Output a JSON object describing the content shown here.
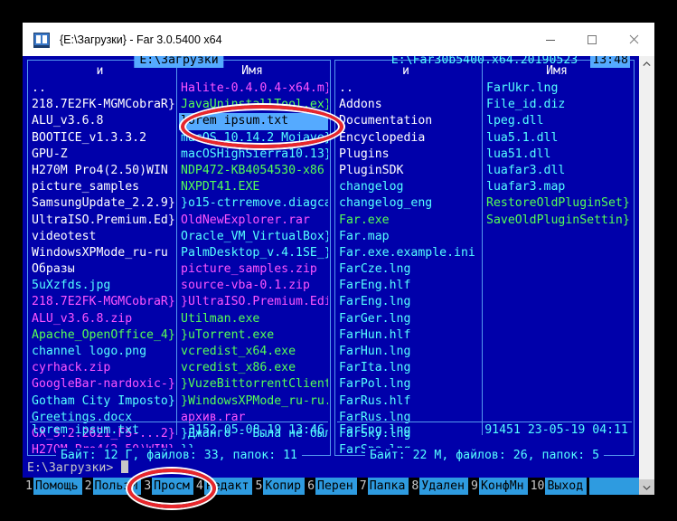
{
  "window": {
    "title": "{E:\\Загрузки} - Far 3.0.5400 x64",
    "icon": "far-manager-icon",
    "minimize_label": "minimize-icon",
    "maximize_label": "maximize-icon",
    "close_label": "close-icon"
  },
  "colors": {
    "panel_bg": "#0000aa",
    "panel_border": "#5599ee",
    "title_highlight": "#55aaff",
    "file_default": "#55ffff",
    "folder": "#ffffff",
    "executable": "#55ff55",
    "archive": "#ff55ff",
    "selection_bg": "#55aaff",
    "keybar_bg": "#2e9be0",
    "annotation": "#e8262b"
  },
  "left_panel": {
    "title": "E:\\Загрузки",
    "col_head_1": "и",
    "col_head_2": "Имя",
    "column_a": [
      {
        "name": "..",
        "type": "dir"
      },
      {
        "name": "218.7E2FK-MGMCobraR",
        "type": "dir",
        "cont": true
      },
      {
        "name": "ALU_v3.6.8",
        "type": "dir"
      },
      {
        "name": "BOOTICE_v1.3.3.2",
        "type": "dir"
      },
      {
        "name": "GPU-Z",
        "type": "dir"
      },
      {
        "name": "H270M Pro4(2.50)WIN",
        "type": "dir"
      },
      {
        "name": "picture_samples",
        "type": "dir"
      },
      {
        "name": "SamsungUpdate_2.2.9",
        "type": "dir",
        "cont": true
      },
      {
        "name": "UltraISO.Premium.Ed",
        "type": "dir",
        "cont": true
      },
      {
        "name": "videotest",
        "type": "dir"
      },
      {
        "name": "WindowsXPMode_ru-ru",
        "type": "dir"
      },
      {
        "name": "Образы",
        "type": "dir"
      },
      {
        "name": "5uXzfds.jpg",
        "type": "file"
      },
      {
        "name": "218.7E2FK-MGMCobraR",
        "type": "arc",
        "cont": true
      },
      {
        "name": "ALU_v3.6.8.zip",
        "type": "arc"
      },
      {
        "name": "Apache_OpenOffice_4",
        "type": "exe",
        "cont": true
      },
      {
        "name": "channel logo.png",
        "type": "file"
      },
      {
        "name": "cyrhack.zip",
        "type": "arc"
      },
      {
        "name": "GoogleBar-nardoxic-",
        "type": "arc",
        "cont": true
      },
      {
        "name": "Gotham City Imposto",
        "type": "file",
        "cont": true
      },
      {
        "name": "Greetings.docx",
        "type": "file"
      },
      {
        "name": "GX_5.2.2621_FS-...2",
        "type": "arc",
        "cont": true
      },
      {
        "name": "H270M Pro4(2.50)WIN",
        "type": "arc",
        "cont": true
      }
    ],
    "column_b": [
      {
        "name": "Halite-0.4.0.4-x64.m",
        "type": "arc",
        "cont": true
      },
      {
        "name": "JavaUninstallTool.ex",
        "type": "exe",
        "cont": true
      },
      {
        "name": "lorem ipsum.txt",
        "type": "file",
        "selected": true
      },
      {
        "name": "macOS_10.14.2_Mojave",
        "type": "file",
        "cont": true
      },
      {
        "name": "macOSHighSierra10.13",
        "type": "file",
        "cont": true
      },
      {
        "name": "NDP472-KB4054530-x86",
        "type": "exe"
      },
      {
        "name": "NXPDT41.EXE",
        "type": "exe"
      },
      {
        "name": "o15-ctrremove.diagca",
        "type": "file",
        "cont": true,
        "lead": true
      },
      {
        "name": "OldNewExplorer.rar",
        "type": "arc"
      },
      {
        "name": "Oracle_VM_VirtualBox",
        "type": "file",
        "cont": true
      },
      {
        "name": "PalmDesktop_v.4.1SE_",
        "type": "file",
        "cont": true
      },
      {
        "name": "picture_samples.zip",
        "type": "arc"
      },
      {
        "name": "source-vba-0.1.zip",
        "type": "arc"
      },
      {
        "name": "UltraISO.Premium.Edi",
        "type": "arc",
        "cont": true,
        "lead": true
      },
      {
        "name": "Utilman.exe",
        "type": "exe"
      },
      {
        "name": "uTorrent.exe",
        "type": "exe",
        "lead": true
      },
      {
        "name": "vcredist_x64.exe",
        "type": "exe"
      },
      {
        "name": "vcredist_x86.exe",
        "type": "exe"
      },
      {
        "name": "VuzeBittorrentClient",
        "type": "exe",
        "cont": true,
        "lead": true
      },
      {
        "name": "WindowsXPMode_ru-ru.",
        "type": "exe",
        "cont": true,
        "lead": true
      },
      {
        "name": "архив.rar",
        "type": "arc"
      },
      {
        "name": "Джанго - Была не был",
        "type": "file",
        "cont": true,
        "lead": true
      },
      {
        "name": "",
        "type": "file",
        "cont": true,
        "lead": true
      }
    ],
    "info_name": "lorem ipsum.txt",
    "info_meta": "3152 05-08-19 13:46",
    "total": "Байт: 12 Г, файлов: 33, папок: 11"
  },
  "right_panel": {
    "title": "E:\\Far30b5400.x64.20190523",
    "clock": "13:48",
    "col_head_1": "и",
    "col_head_2": "Имя",
    "column_a": [
      {
        "name": "..",
        "type": "dir"
      },
      {
        "name": "Addons",
        "type": "dir"
      },
      {
        "name": "Documentation",
        "type": "dir"
      },
      {
        "name": "Encyclopedia",
        "type": "dir"
      },
      {
        "name": "Plugins",
        "type": "dir"
      },
      {
        "name": "PluginSDK",
        "type": "dir"
      },
      {
        "name": "changelog",
        "type": "file"
      },
      {
        "name": "changelog_eng",
        "type": "file"
      },
      {
        "name": "Far.exe",
        "type": "exe"
      },
      {
        "name": "Far.map",
        "type": "file"
      },
      {
        "name": "Far.exe.example.ini",
        "type": "file"
      },
      {
        "name": "FarCze.lng",
        "type": "file"
      },
      {
        "name": "FarEng.hlf",
        "type": "file"
      },
      {
        "name": "FarEng.lng",
        "type": "file"
      },
      {
        "name": "FarGer.lng",
        "type": "file"
      },
      {
        "name": "FarHun.hlf",
        "type": "file"
      },
      {
        "name": "FarHun.lng",
        "type": "file"
      },
      {
        "name": "FarIta.lng",
        "type": "file"
      },
      {
        "name": "FarPol.lng",
        "type": "file"
      },
      {
        "name": "FarRus.hlf",
        "type": "file"
      },
      {
        "name": "FarRus.lng",
        "type": "file"
      },
      {
        "name": "FarSky.lng",
        "type": "file"
      },
      {
        "name": "FarSpa.lng",
        "type": "file"
      }
    ],
    "column_b": [
      {
        "name": "FarUkr.lng",
        "type": "file"
      },
      {
        "name": "File_id.diz",
        "type": "file"
      },
      {
        "name": "lpeg.dll",
        "type": "file"
      },
      {
        "name": "lua5.1.dll",
        "type": "file"
      },
      {
        "name": "lua51.dll",
        "type": "file"
      },
      {
        "name": "luafar3.dll",
        "type": "file"
      },
      {
        "name": "luafar3.map",
        "type": "file"
      },
      {
        "name": "RestoreOldPluginSet",
        "type": "exe",
        "cont": true
      },
      {
        "name": "SaveOldPluginSettin",
        "type": "exe",
        "cont": true
      }
    ],
    "info_name": "FarEng.lng",
    "info_meta": "91451 23-05-19 04:11",
    "total": "Байт: 22 М, файлов: 26, папок: 5"
  },
  "command_line": {
    "prompt": "E:\\Загрузки>"
  },
  "keybar": [
    {
      "num": "1",
      "label": "Помощь"
    },
    {
      "num": "2",
      "label": "ПользМ"
    },
    {
      "num": "3",
      "label": "Просм",
      "highlight": true
    },
    {
      "num": "4",
      "label": "Редакт"
    },
    {
      "num": "5",
      "label": "Копир"
    },
    {
      "num": "6",
      "label": "Перен"
    },
    {
      "num": "7",
      "label": "Папка"
    },
    {
      "num": "8",
      "label": "Удален"
    },
    {
      "num": "9",
      "label": "КонфМн"
    },
    {
      "num": "10",
      "label": "Выход"
    }
  ],
  "scrollbar": {
    "up_arrow": "chevron-up-icon",
    "down_arrow": "chevron-down-icon"
  },
  "annotations": [
    {
      "name": "selected-file-highlight",
      "target": "lorem ipsum.txt"
    },
    {
      "name": "f3-view-key-highlight",
      "target": "3Просм"
    }
  ]
}
